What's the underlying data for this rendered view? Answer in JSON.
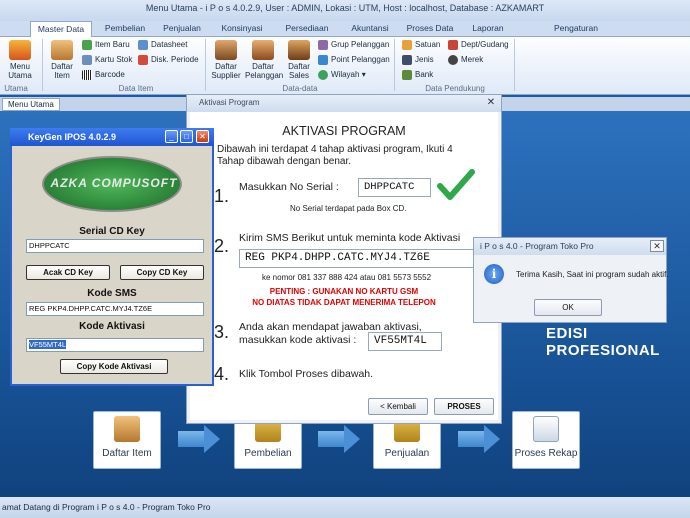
{
  "window": {
    "title": "Menu Utama - i P o s 4.0.2.9,  User : ADMIN, Lokasi : UTM, Host : localhost, Database : AZKAMART"
  },
  "tabs": [
    "Master Data",
    "Pembelian",
    "Penjualan",
    "Konsinyasi",
    "Persediaan",
    "Akuntansi",
    "Proses Data",
    "Laporan",
    "Pengaturan"
  ],
  "ribbon": {
    "menu_utama": "Menu Utama",
    "daftar_item": "Daftar\nItem",
    "item_baru": "Item Baru",
    "kartu_stok": "Kartu Stok",
    "barcode": "Barcode",
    "datasheet": "Datasheet",
    "disk_periode": "Disk. Periode",
    "group_item": "Data Item",
    "group_utama": "Utama",
    "daftar_supplier": "Daftar\nSupplier",
    "daftar_pelanggan": "Daftar\nPelanggan",
    "daftar_sales": "Daftar\nSales",
    "grup_pelanggan": "Grup Pelanggan",
    "point_pelanggan": "Point Pelanggan",
    "wilayah": "Wilayah",
    "group_data": "Data-data",
    "satuan": "Satuan",
    "jenis": "Jenis",
    "bank": "Bank",
    "dept_gudang": "Dept/Gudang",
    "merek": "Merek",
    "group_pendukung": "Data Pendukung"
  },
  "doc_tab": "Menu Utama",
  "edisi": "EDISI PROFESIONAL",
  "flow": [
    "Daftar Item",
    "Pembelian",
    "Penjualan",
    "Proses Rekap"
  ],
  "status": "amat Datang di Program i P o s  4.0 - Program Toko Pro",
  "activation": {
    "title": "Aktivasi Program",
    "heading": "AKTIVASI PROGRAM",
    "intro1": "Dibawah ini terdapat 4 tahap aktivasi program, Ikuti 4",
    "intro2": "Tahap dibawah dengan benar.",
    "step1_num": "1.",
    "step1_label": "Masukkan No Serial :",
    "serial": "DHPPCATC",
    "step1_note": "No Serial terdapat pada Box CD.",
    "step2_num": "2.",
    "step2_label": "Kirim SMS Berikut untuk meminta kode Aktivasi",
    "sms": "REG PKP4.DHPP.CATC.MYJ4.TZ6E",
    "step2_note": "ke nomor 081 337 888 424 atau 081 5573 5552",
    "warn1": "PENTING : GUNAKAN NO KARTU GSM",
    "warn2": "NO DIATAS TIDAK DAPAT MENERIMA TELEPON",
    "step3_num": "3.",
    "step3_label1": "Anda akan mendapat jawaban aktivasi,",
    "step3_label2": "masukkan kode aktivasi :",
    "code": "VF55MT4L",
    "step4_num": "4.",
    "step4_label": "Klik Tombol Proses dibawah.",
    "back": "< Kembali",
    "proses": "PROSES"
  },
  "keygen": {
    "title": "KeyGen IPOS 4.0.2.9",
    "logo": "AZKA COMPUSOFT",
    "serial_label": "Serial CD Key",
    "serial": "DHPPCATC",
    "acak": "Acak CD Key",
    "copy_cd": "Copy CD Key",
    "sms_label": "Kode SMS",
    "sms": "REG PKP4.DHPP.CATC.MYJ4.TZ6E",
    "aktivasi_label": "Kode Aktivasi",
    "aktivasi": "VF55MT4L",
    "copy_akt": "Copy Kode Aktivasi"
  },
  "message": {
    "title": "i P o s  4.0 - Program Toko Pro",
    "text": "Terima Kasih, Saat ini program sudah aktif.",
    "ok": "OK"
  },
  "colors": {
    "accent": "#1d5aa0",
    "warning": "#e00000",
    "keygen_title": "#1f55cf"
  }
}
